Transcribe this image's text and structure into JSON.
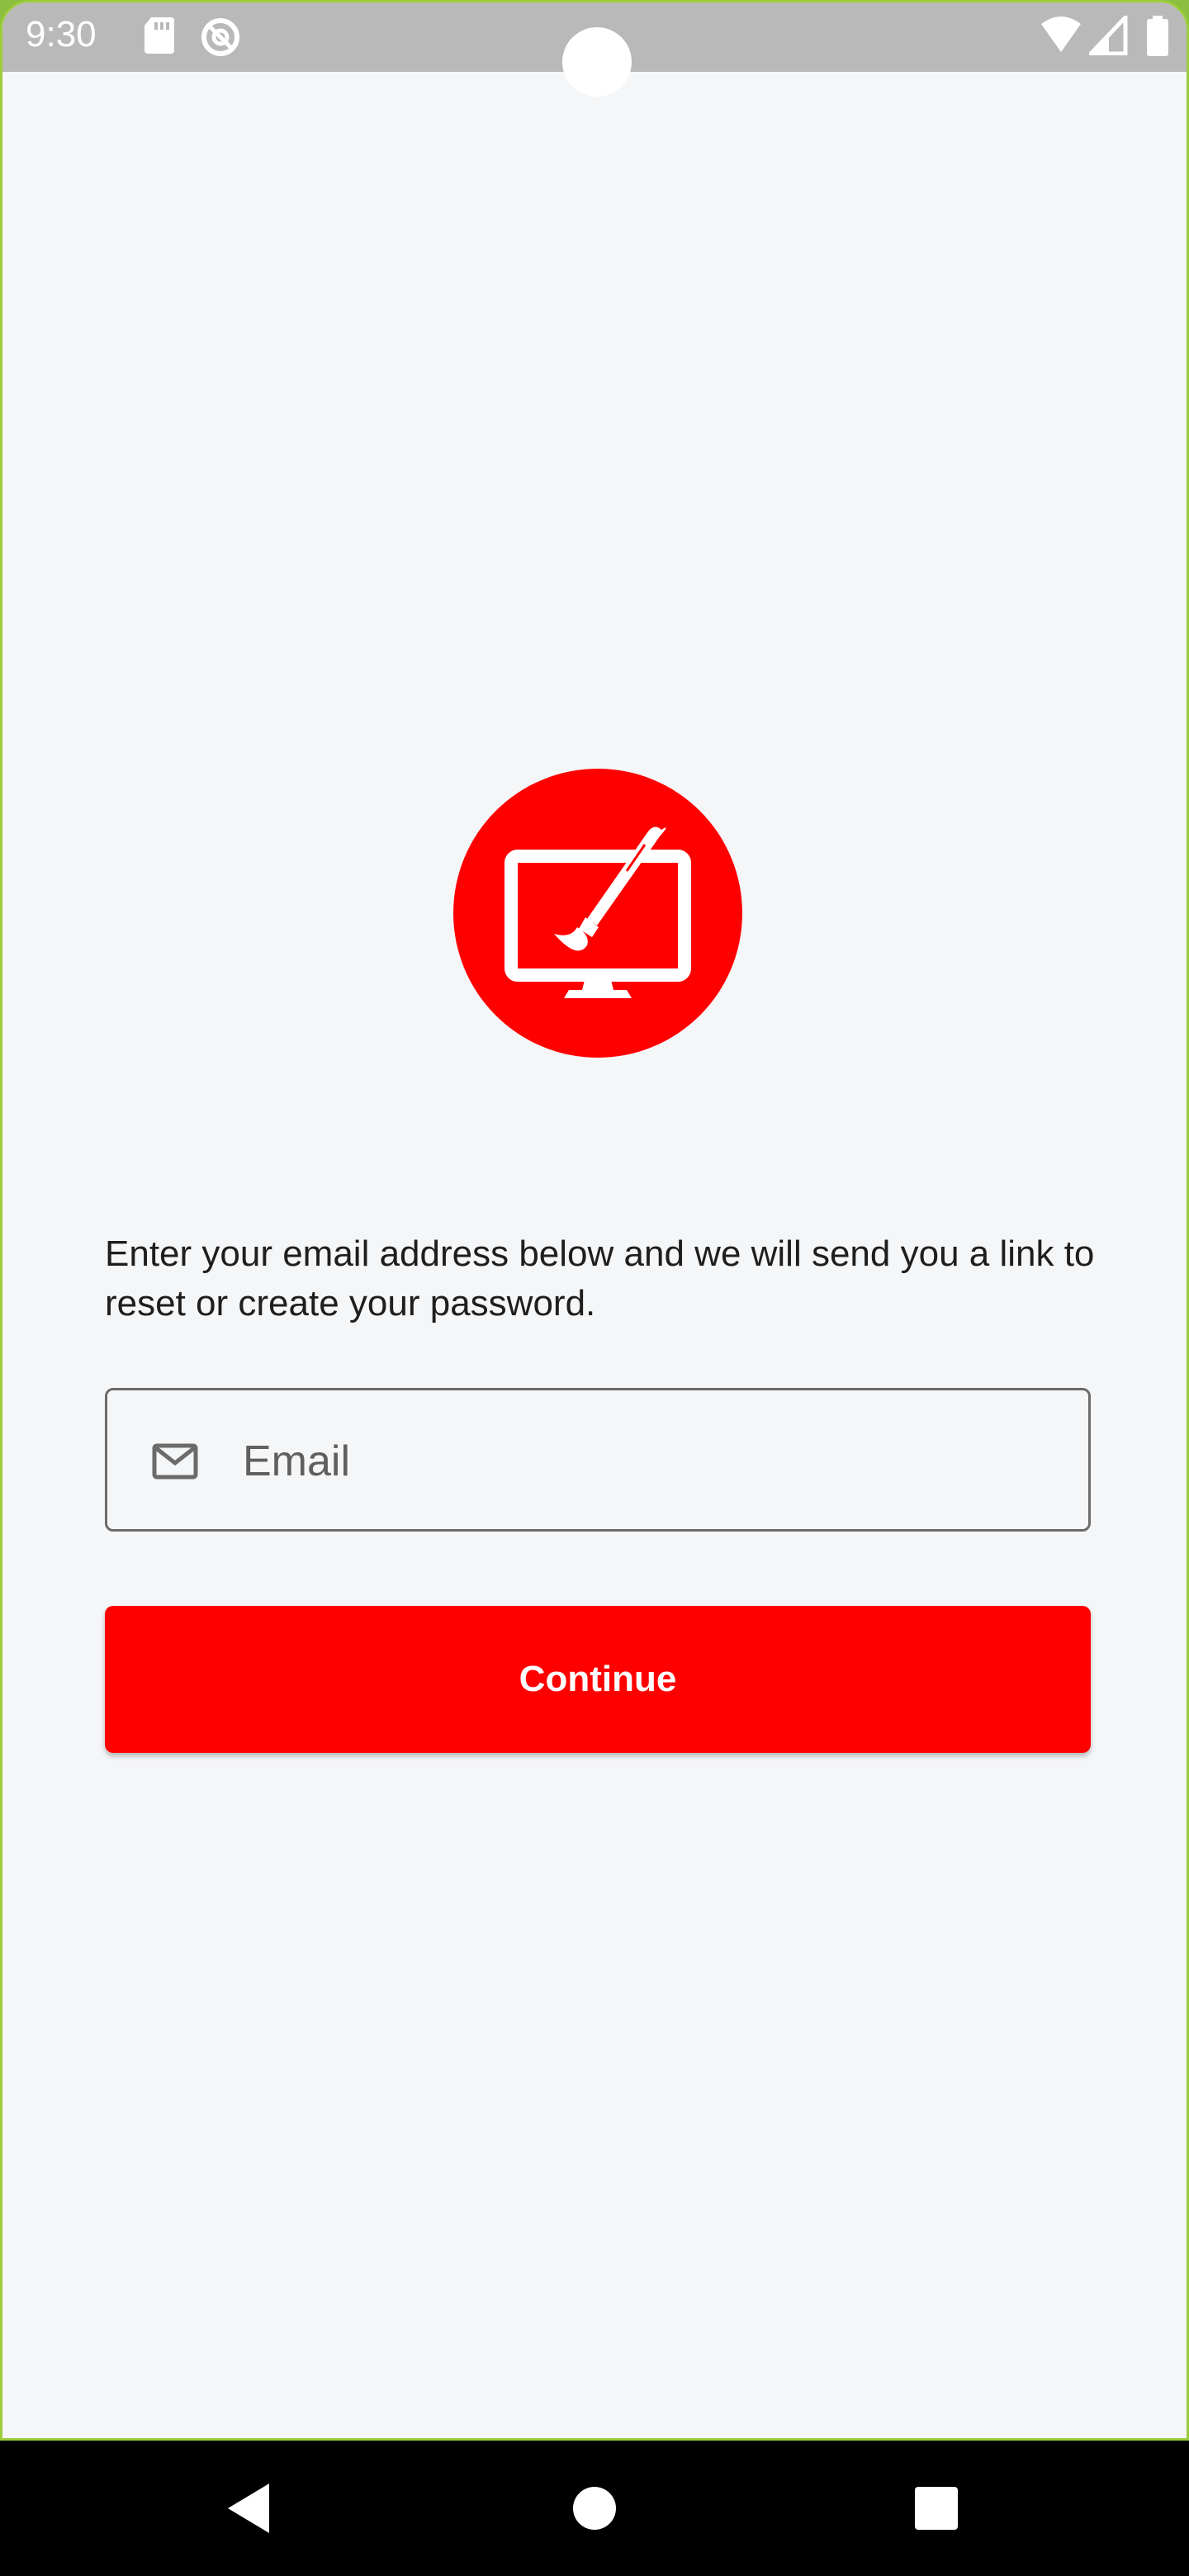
{
  "status_bar": {
    "time": "9:30",
    "icons": [
      "sd-card-icon",
      "do-not-disturb-icon",
      "wifi-icon",
      "signal-icon",
      "battery-icon"
    ]
  },
  "app_logo": {
    "icon": "monitor-paintbrush-icon",
    "background_color": "#ff0000"
  },
  "reset_password": {
    "instructions": "Enter your email address below and we will send you a link to reset or create your password.",
    "email_field": {
      "icon": "mail-icon",
      "placeholder": "Email",
      "value": ""
    },
    "continue_label": "Continue",
    "accent_color": "#ff0000"
  },
  "navigation_bar": {
    "buttons": [
      "back-icon",
      "home-icon",
      "recents-icon"
    ]
  }
}
